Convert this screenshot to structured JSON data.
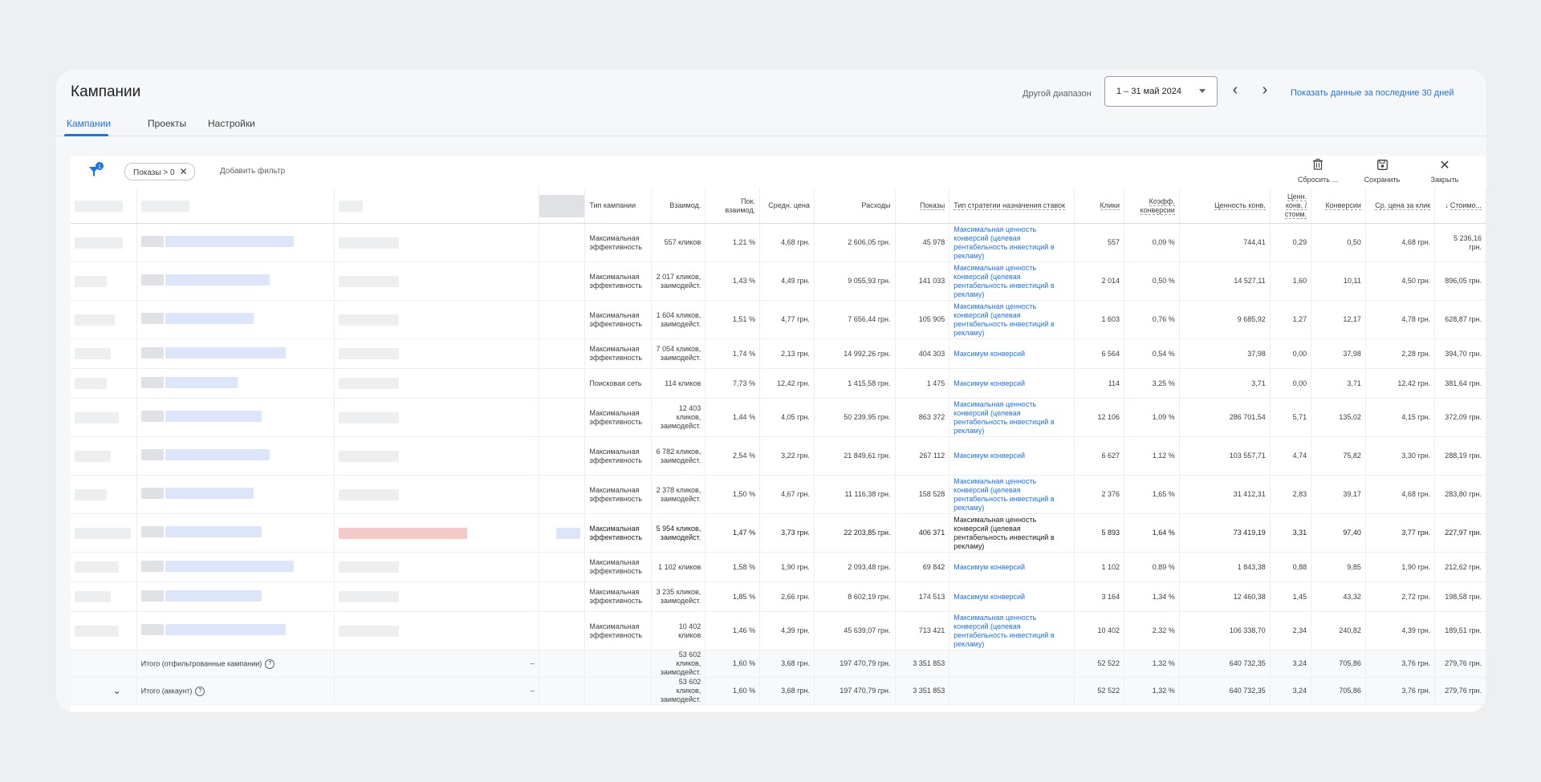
{
  "header": {
    "title": "Кампании",
    "range_label": "Другой диапазон",
    "date_range": "1 – 31 май 2024",
    "last_30_link": "Показать данные за последние 30 дней"
  },
  "tabs": [
    {
      "label": "Кампании",
      "active": true
    },
    {
      "label": "Проекты",
      "active": false
    },
    {
      "label": "Настройки",
      "active": false
    }
  ],
  "toolbar": {
    "filter_badge": "1",
    "filter_chip": "Показы > 0",
    "add_filter": "Добавить фильтр",
    "reset_label": "Сбросить ...",
    "save_label": "Сохранить",
    "close_label": "Закрыть"
  },
  "columns": [
    "Тип кампании",
    "Взаимод.",
    "Пок. взаимод.",
    "Средн. цена",
    "Расходы",
    "Показы",
    "Тип стратегии назначения ставок",
    "Клики",
    "Коэфф. конверсии",
    "Ценность конв.",
    "Ценн. конв. / стоим.",
    "Конверсии",
    "Ср. цена за клик",
    "Стоимо..."
  ],
  "rows": [
    {
      "type": "Максимальная эффективность",
      "interactions": "557 кликов",
      "rate": "1,21 %",
      "avg_cost": "4,68 грн.",
      "cost": "2 606,05 грн.",
      "impr": "45 978",
      "strategy": "Максимальная ценность конверсий (целевая рентабельность инвестиций в рекламу)",
      "clicks": "557",
      "conv_rate": "0,09 %",
      "conv_value": "744,41",
      "value_cost": "0,29",
      "conv": "0,50",
      "cpc": "4,68 грн.",
      "cost_conv": "5 236,16 грн."
    },
    {
      "type": "Максимальная эффективность",
      "interactions": "2 017 кликов, заимодейст.",
      "rate": "1,43 %",
      "avg_cost": "4,49 грн.",
      "cost": "9 055,93 грн.",
      "impr": "141 033",
      "strategy": "Максимальная ценность конверсий (целевая рентабельность инвестиций в рекламу)",
      "clicks": "2 014",
      "conv_rate": "0,50 %",
      "conv_value": "14 527,11",
      "value_cost": "1,60",
      "conv": "10,11",
      "cpc": "4,50 грн.",
      "cost_conv": "896,05 грн."
    },
    {
      "type": "Максимальная эффективность",
      "interactions": "1 604 кликов, заимодейст.",
      "rate": "1,51 %",
      "avg_cost": "4,77 грн.",
      "cost": "7 656,44 грн.",
      "impr": "105 905",
      "strategy": "Максимальная ценность конверсий (целевая рентабельность инвестиций в рекламу)",
      "clicks": "1 603",
      "conv_rate": "0,76 %",
      "conv_value": "9 685,92",
      "value_cost": "1,27",
      "conv": "12,17",
      "cpc": "4,78 грн.",
      "cost_conv": "628,87 грн."
    },
    {
      "type": "Максимальная эффективность",
      "interactions": "7 054 кликов, заимодейст.",
      "rate": "1,74 %",
      "avg_cost": "2,13 грн.",
      "cost": "14 992,26 грн.",
      "impr": "404 303",
      "strategy": "Максимум конверсий",
      "clicks": "6 564",
      "conv_rate": "0,54 %",
      "conv_value": "37,98",
      "value_cost": "0,00",
      "conv": "37,98",
      "cpc": "2,28 грн.",
      "cost_conv": "394,70 грн.",
      "short": true
    },
    {
      "type": "Поисковая сеть",
      "interactions": "114 кликов",
      "rate": "7,73 %",
      "avg_cost": "12,42 грн.",
      "cost": "1 415,58 грн.",
      "impr": "1 475",
      "strategy": "Максимум конверсий",
      "clicks": "114",
      "conv_rate": "3,25 %",
      "conv_value": "3,71",
      "value_cost": "0,00",
      "conv": "3,71",
      "cpc": "12,42 грн.",
      "cost_conv": "381,64 грн.",
      "short": true
    },
    {
      "type": "Максимальная эффективность",
      "interactions": "12 403 кликов, заимодейст.",
      "rate": "1,44 %",
      "avg_cost": "4,05 грн.",
      "cost": "50 239,95 грн.",
      "impr": "863 372",
      "strategy": "Максимальная ценность конверсий (целевая рентабельность инвестиций в рекламу)",
      "clicks": "12 106",
      "conv_rate": "1,09 %",
      "conv_value": "286 701,54",
      "value_cost": "5,71",
      "conv": "135,02",
      "cpc": "4,15 грн.",
      "cost_conv": "372,09 грн."
    },
    {
      "type": "Максимальная эффективность",
      "interactions": "6 782 кликов, заимодейст.",
      "rate": "2,54 %",
      "avg_cost": "3,22 грн.",
      "cost": "21 849,61 грн.",
      "impr": "267 112",
      "strategy": "Максимум конверсий",
      "clicks": "6 627",
      "conv_rate": "1,12 %",
      "conv_value": "103 557,71",
      "value_cost": "4,74",
      "conv": "75,82",
      "cpc": "3,30 грн.",
      "cost_conv": "288,19 грн."
    },
    {
      "type": "Максимальная эффективность",
      "interactions": "2 378 кликов, заимодейст.",
      "rate": "1,50 %",
      "avg_cost": "4,67 грн.",
      "cost": "11 116,38 грн.",
      "impr": "158 528",
      "strategy": "Максимальная ценность конверсий (целевая рентабельность инвестиций в рекламу)",
      "clicks": "2 376",
      "conv_rate": "1,65 %",
      "conv_value": "31 412,31",
      "value_cost": "2,83",
      "conv": "39,17",
      "cpc": "4,68 грн.",
      "cost_conv": "283,80 грн."
    },
    {
      "type": "Максимальная эффективность",
      "interactions": "5 954 кликов, заимодейст.",
      "rate": "1,47 %",
      "avg_cost": "3,73 грн.",
      "cost": "22 203,85 грн.",
      "impr": "406 371",
      "strategy": "Максимальная ценность конверсий (целевая рентабельность инвестиций в рекламу)",
      "clicks": "5 893",
      "conv_rate": "1,64 %",
      "conv_value": "73 419,19",
      "value_cost": "3,31",
      "conv": "97,40",
      "cpc": "3,77 грн.",
      "cost_conv": "227,97 грн.",
      "bold": true
    },
    {
      "type": "Максимальная эффективность",
      "interactions": "1 102 кликов",
      "rate": "1,58 %",
      "avg_cost": "1,90 грн.",
      "cost": "2 093,48 грн.",
      "impr": "69 842",
      "strategy": "Максимум конверсий",
      "clicks": "1 102",
      "conv_rate": "0,89 %",
      "conv_value": "1 843,38",
      "value_cost": "0,88",
      "conv": "9,85",
      "cpc": "1,90 грн.",
      "cost_conv": "212,62 грн.",
      "short": true
    },
    {
      "type": "Максимальная эффективность",
      "interactions": "3 235 кликов, заимодейст.",
      "rate": "1,85 %",
      "avg_cost": "2,66 грн.",
      "cost": "8 602,19 грн.",
      "impr": "174 513",
      "strategy": "Максимум конверсий",
      "clicks": "3 164",
      "conv_rate": "1,34 %",
      "conv_value": "12 460,38",
      "value_cost": "1,45",
      "conv": "43,32",
      "cpc": "2,72 грн.",
      "cost_conv": "198,58 грн.",
      "short": true
    },
    {
      "type": "Максимальная эффективность",
      "interactions": "10 402 кликов",
      "rate": "1,46 %",
      "avg_cost": "4,39 грн.",
      "cost": "45 639,07 грн.",
      "impr": "713 421",
      "strategy": "Максимальная ценность конверсий (целевая рентабельность инвестиций в рекламу)",
      "clicks": "10 402",
      "conv_rate": "2,32 %",
      "conv_value": "106 338,70",
      "value_cost": "2,34",
      "conv": "240,82",
      "cpc": "4,39 грн.",
      "cost_conv": "189,51 грн."
    }
  ],
  "totals": [
    {
      "label": "Итого (отфильтрованные кампании)",
      "dash": "–",
      "interactions": "53 602 кликов, заимодейст.",
      "rate": "1,60 %",
      "avg_cost": "3,68 грн.",
      "cost": "197 470,79 грн.",
      "impr": "3 351 853",
      "clicks": "52 522",
      "conv_rate": "1,32 %",
      "conv_value": "640 732,35",
      "value_cost": "3,24",
      "conv": "705,86",
      "cpc": "3,76 грн.",
      "cost_conv": "279,76 грн."
    },
    {
      "label": "Итого (аккаунт)",
      "dash": "–",
      "interactions": "53 602 кликов, заимодейст.",
      "rate": "1,60 %",
      "avg_cost": "3,68 грн.",
      "cost": "197 470,79 грн.",
      "impr": "3 351 853",
      "clicks": "52 522",
      "conv_rate": "1,32 %",
      "conv_value": "640 732,35",
      "value_cost": "3,24",
      "conv": "705,86",
      "cpc": "3,76 грн.",
      "cost_conv": "279,76 грн."
    }
  ],
  "colors": {
    "accent": "#1a73e8",
    "text": "#202124",
    "muted": "#5f6368"
  }
}
